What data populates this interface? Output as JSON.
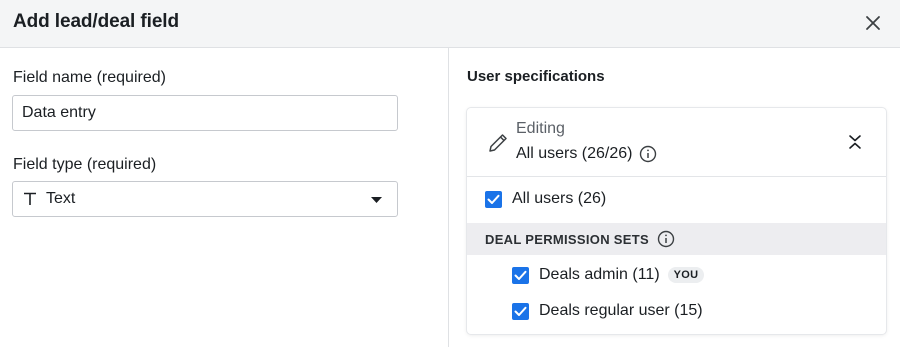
{
  "dialog": {
    "title": "Add lead/deal field",
    "close_icon": "close-icon"
  },
  "form": {
    "field_name_label": "Field name (required)",
    "field_name_value": "Data entry",
    "field_type_label": "Field type (required)",
    "field_type_value": "Text",
    "field_type_icon": "text-type-icon"
  },
  "user_specs": {
    "title": "User specifications",
    "editing_label": "Editing",
    "editing_value": "All users (26/26)",
    "all_users_label": "All users (26)",
    "all_users_checked": true,
    "permission_sets_heading": "DEAL PERMISSION SETS",
    "permission_sets": [
      {
        "label": "Deals admin (11)",
        "checked": true,
        "badge": "YOU"
      },
      {
        "label": "Deals regular user (15)",
        "checked": true
      }
    ]
  },
  "colors": {
    "accent": "#1a73e8",
    "header_bg": "#f4f5f6",
    "band_bg": "#ededf0"
  }
}
